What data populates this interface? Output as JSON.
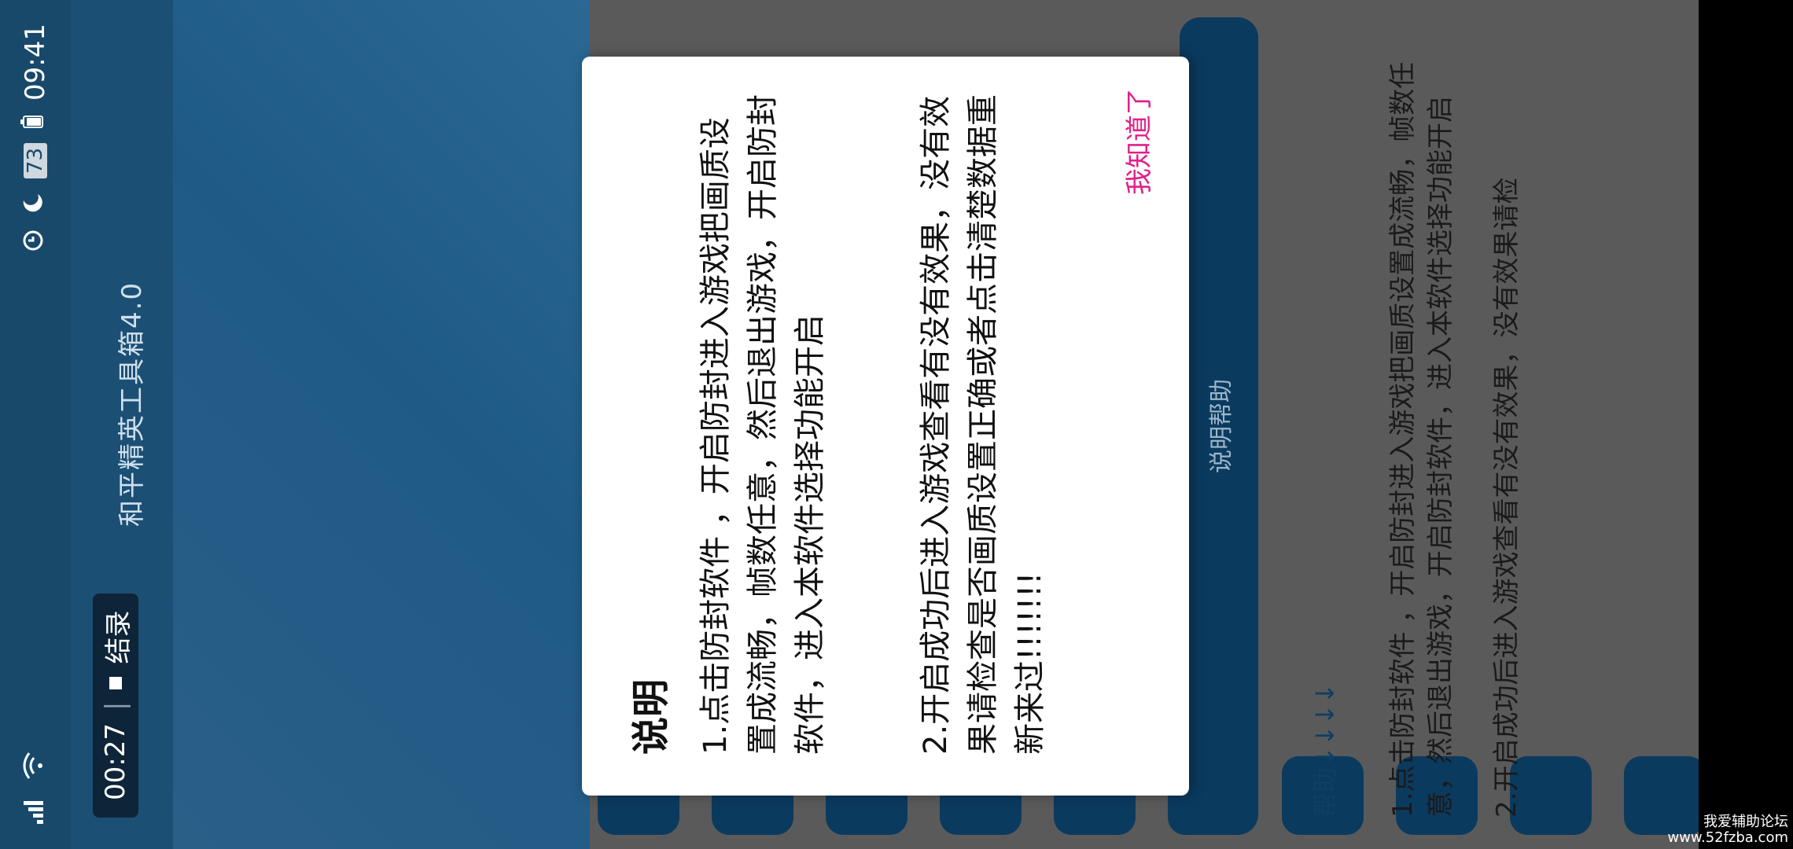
{
  "status": {
    "time": "09:41",
    "battery": "73",
    "rec_time": "00:27",
    "rec_label": "结录"
  },
  "app": {
    "title": "和平精英工具箱4.0"
  },
  "help_button": {
    "label": "说明帮助"
  },
  "help_section": {
    "title": "帮助↓↓↓↓",
    "text1": "1.点击防封软件 ，开启防封进入游戏把画质设置成流畅，帧数任意，然后退出游戏，开启防封软件，进入本软件选择功能开启",
    "text2": "2.开启成功后进入游戏查看有没有效果，没有效果请检"
  },
  "dialog": {
    "title": "说明",
    "para1": "1.点击防封软件 ，开启防封进入游戏把画质设置成流畅，帧数任意，然后退出游戏，开启防封软件，进入本软件选择功能开启",
    "para2": "2.开启成功后进入游戏查看有没有效果，没有效果请检查是否画质设置正确或者点击清楚数据重新来过!!!!!!!",
    "ok": "我知道了"
  },
  "watermark": {
    "line1": "我爱辅助论坛",
    "line2": "www.52fzba.com"
  }
}
